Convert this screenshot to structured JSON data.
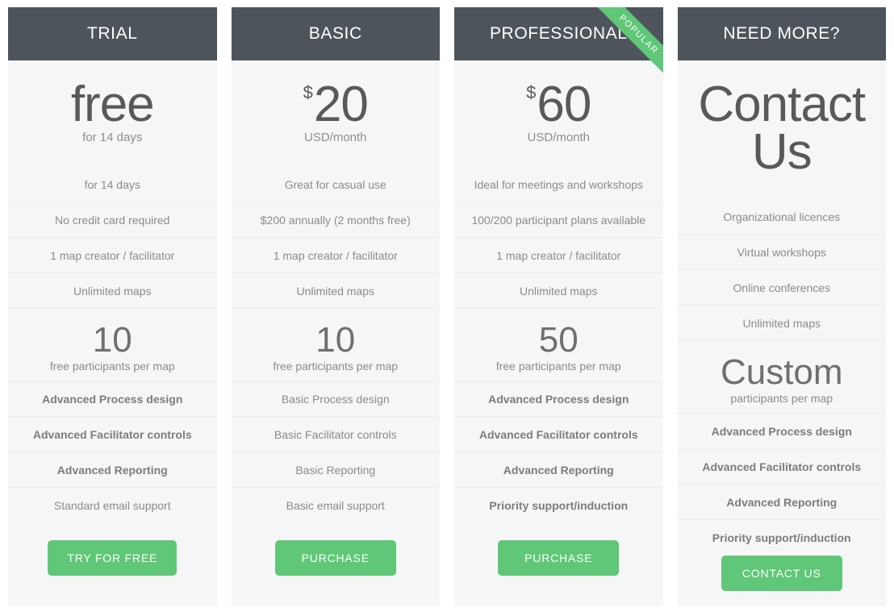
{
  "accent_color": "#5fc777",
  "header_color": "#4e545c",
  "card_bg": "#f6f6f6",
  "plans": [
    {
      "name": "TRIAL",
      "currency": "",
      "price": "free",
      "price_sub": "for 14 days",
      "tagline": "for 14 days",
      "features_top": [
        "No credit card required",
        "1 map creator / facilitator",
        "Unlimited maps"
      ],
      "participants_number": "10",
      "participants_caption": "free participants per map",
      "features_bottom": [
        {
          "label": "Advanced Process design",
          "bold": true
        },
        {
          "label": "Advanced Facilitator controls",
          "bold": true
        },
        {
          "label": "Advanced Reporting",
          "bold": true
        },
        {
          "label": "Standard email support",
          "bold": false
        }
      ],
      "cta": "TRY FOR FREE",
      "ribbon": ""
    },
    {
      "name": "BASIC",
      "currency": "$",
      "price": "20",
      "price_sub": "USD/month",
      "tagline": "Great for casual use",
      "features_top": [
        "$200 annually (2 months free)",
        "1 map creator / facilitator",
        "Unlimited maps"
      ],
      "participants_number": "10",
      "participants_caption": "free participants per map",
      "features_bottom": [
        {
          "label": "Basic Process design",
          "bold": false
        },
        {
          "label": "Basic Facilitator controls",
          "bold": false
        },
        {
          "label": "Basic Reporting",
          "bold": false
        },
        {
          "label": "Basic email support",
          "bold": false
        }
      ],
      "cta": "PURCHASE",
      "ribbon": ""
    },
    {
      "name": "PROFESSIONAL",
      "currency": "$",
      "price": "60",
      "price_sub": "USD/month",
      "tagline": "Ideal for meetings and workshops",
      "features_top": [
        "100/200 participant plans available",
        "1 map creator / facilitator",
        "Unlimited maps"
      ],
      "participants_number": "50",
      "participants_caption": "free participants per map",
      "features_bottom": [
        {
          "label": "Advanced Process design",
          "bold": true
        },
        {
          "label": "Advanced Facilitator controls",
          "bold": true
        },
        {
          "label": "Advanced Reporting",
          "bold": true
        },
        {
          "label": "Priority support/induction",
          "bold": true
        }
      ],
      "cta": "PURCHASE",
      "ribbon": "POPULAR"
    },
    {
      "name": "NEED MORE?",
      "currency": "",
      "price": "Contact\nUs",
      "price_sub": "",
      "tagline": "Organizational licences",
      "features_top": [
        "Virtual workshops",
        "Online conferences",
        "Unlimited maps"
      ],
      "participants_number": "Custom",
      "participants_caption": "participants per map",
      "features_bottom": [
        {
          "label": "Advanced Process design",
          "bold": true
        },
        {
          "label": "Advanced Facilitator controls",
          "bold": true
        },
        {
          "label": "Advanced Reporting",
          "bold": true
        },
        {
          "label": "Priority support/induction",
          "bold": true
        }
      ],
      "cta": "CONTACT US",
      "ribbon": ""
    }
  ]
}
